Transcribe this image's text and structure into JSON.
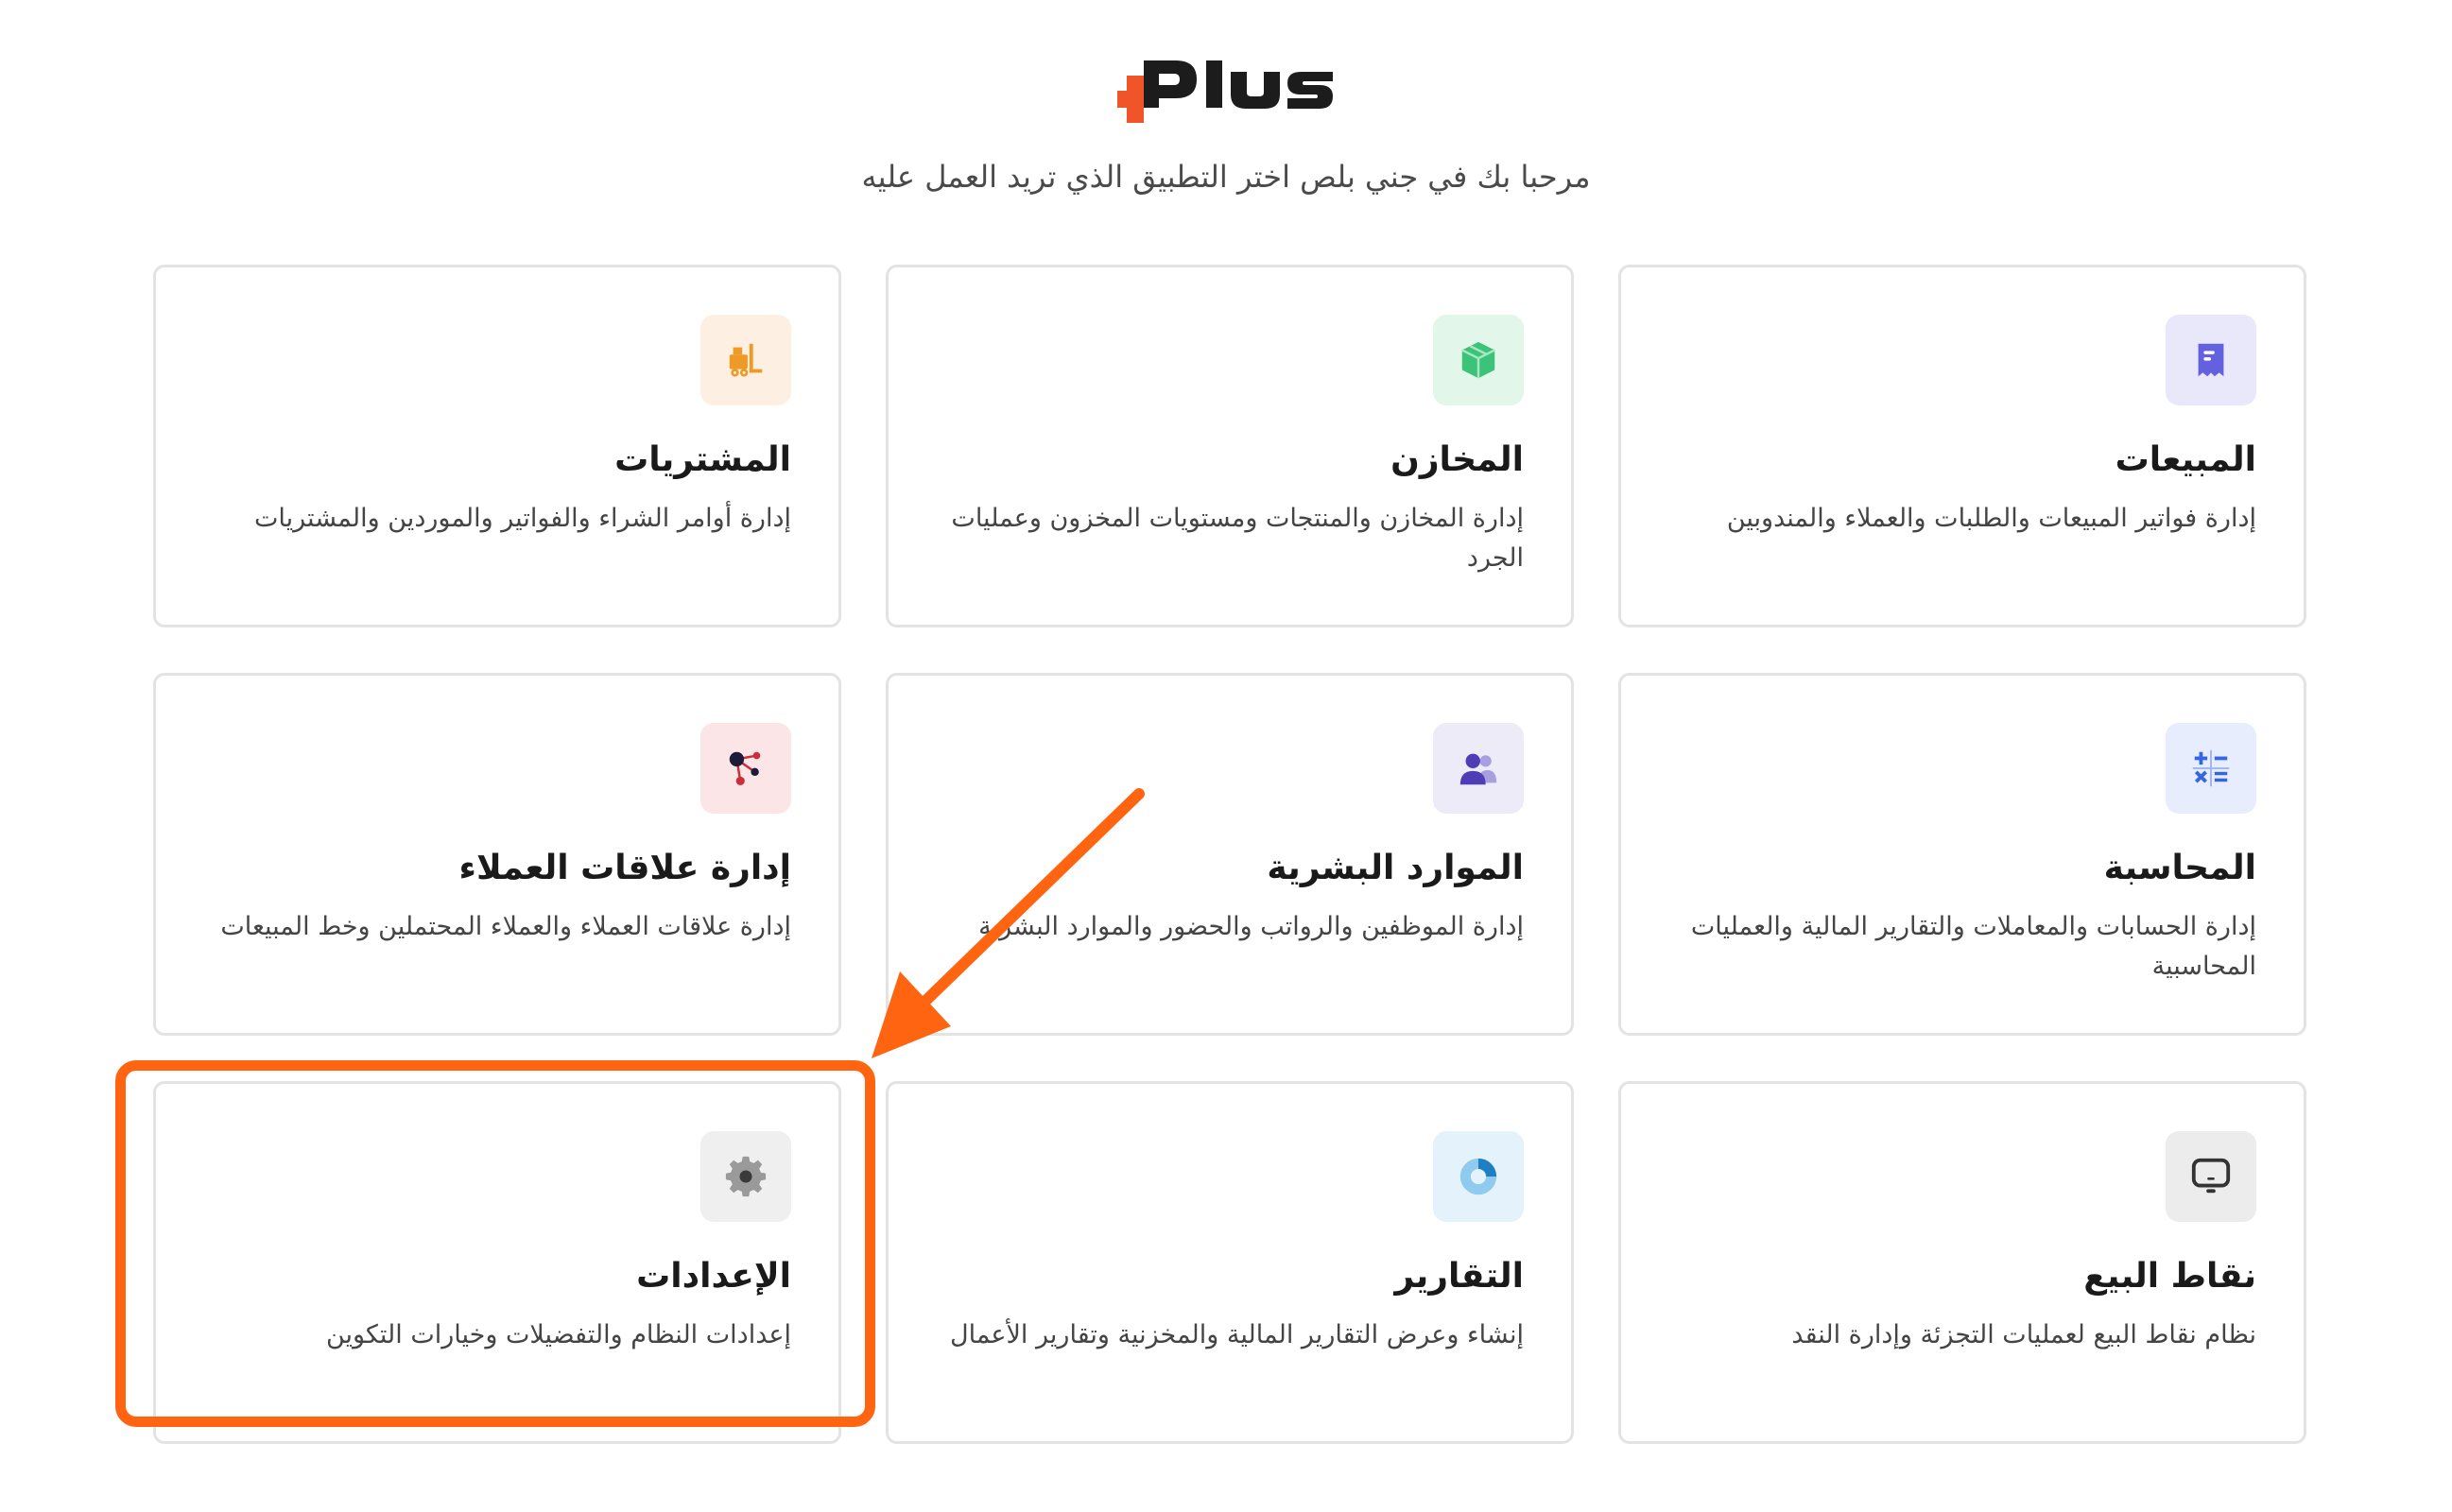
{
  "header": {
    "logo_text": "PLUS",
    "subtitle": "مرحبا بك في جني بلص اختر التطبيق الذي تريد العمل عليه"
  },
  "apps": [
    {
      "title": "المبيعات",
      "desc": "إدارة فواتير المبيعات والطلبات والعملاء والمندوبين",
      "icon": "receipt-icon",
      "bg": "#e9e8fb",
      "color": "#6361e0"
    },
    {
      "title": "المخازن",
      "desc": "إدارة المخازن والمنتجات ومستويات المخزون وعمليات الجرد",
      "icon": "box-icon",
      "bg": "#e3f6ea",
      "color": "#3cc37a"
    },
    {
      "title": "المشتريات",
      "desc": "إدارة أوامر الشراء والفواتير والموردين والمشتريات",
      "icon": "forklift-icon",
      "bg": "#fdf0e2",
      "color": "#ee9a27"
    },
    {
      "title": "المحاسبة",
      "desc": "إدارة الحسابات والمعاملات والتقارير المالية والعمليات المحاسبية",
      "icon": "calculator-icon",
      "bg": "#e7edfc",
      "color": "#3466e4"
    },
    {
      "title": "الموارد البشرية",
      "desc": "إدارة الموظفين والرواتب والحضور والموارد البشرية",
      "icon": "users-icon",
      "bg": "#ecebf7",
      "color": "#4f3db5"
    },
    {
      "title": "إدارة علاقات العملاء",
      "desc": "إدارة علاقات العملاء والعملاء المحتملين وخط المبيعات",
      "icon": "network-icon",
      "bg": "#fbe5e6",
      "color": "#cc2d3a"
    },
    {
      "title": "نقاط البيع",
      "desc": "نظام نقاط البيع لعمليات التجزئة وإدارة النقد",
      "icon": "monitor-icon",
      "bg": "#ececec",
      "color": "#333333"
    },
    {
      "title": "التقارير",
      "desc": "إنشاء وعرض التقارير المالية والمخزنية وتقارير الأعمال",
      "icon": "pie-chart-icon",
      "bg": "#e4f3fb",
      "color": "#3ea2d8"
    },
    {
      "title": "الإعدادات",
      "desc": "إعدادات النظام والتفضيلات وخيارات التكوين",
      "icon": "gear-icon",
      "bg": "#efefef",
      "color": "#8a8a8a"
    }
  ],
  "annotation": {
    "color": "#ff6410",
    "target": "الإعدادات"
  },
  "brand": {
    "logo_dark": "#1c1c1c",
    "logo_accent": "#f0552a"
  }
}
